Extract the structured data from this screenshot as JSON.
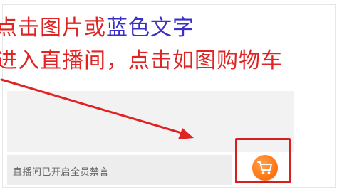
{
  "instruction": {
    "line1_red": "点击图片或",
    "line1_blue": "蓝色文字",
    "line2": "进入直播间，点击如图购物车"
  },
  "chat_bar": {
    "status_text": "直播间已开启全员禁言"
  },
  "cart": {
    "icon": "shopping-cart-icon",
    "color": "#ff7a1a"
  },
  "colors": {
    "instruction_red": "#e02424",
    "instruction_blue": "#3a2fc8",
    "highlight": "#d61f1f"
  }
}
